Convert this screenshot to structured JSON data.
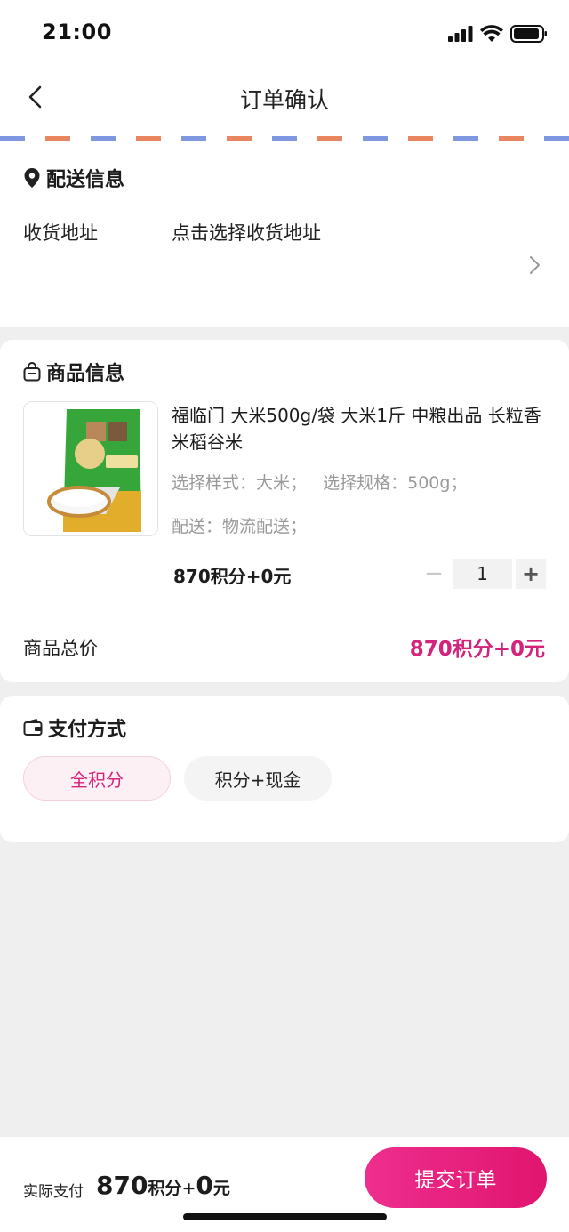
{
  "status_bar": {
    "time": "21:00"
  },
  "nav": {
    "title": "订单确认"
  },
  "stripe_colors": {
    "blue": "#7f97e0",
    "orange": "#e98660"
  },
  "delivery": {
    "title": "配送信息",
    "address_label": "收货地址",
    "address_placeholder": "点击选择收货地址"
  },
  "goods": {
    "title": "商品信息",
    "product": {
      "name": "福临门 大米500g/袋 大米1斤 中粮出品 长粒香米稻谷米",
      "spec": "选择样式：大米；   选择规格：500g；",
      "delivery": "配送：物流配送；",
      "price": "870积分+0元",
      "quantity": "1",
      "minus_symbol": "−",
      "plus_symbol": "+"
    },
    "total_label": "商品总价",
    "total_value": "870积分+0元"
  },
  "payment": {
    "title": "支付方式",
    "options": [
      {
        "label": "全积分",
        "selected": true
      },
      {
        "label": "积分+现金",
        "selected": false
      }
    ]
  },
  "footer": {
    "pay_label": "实际支付",
    "amount_points": "870",
    "amount_points_unit": "积分",
    "amount_plus": "+",
    "amount_cash": "0",
    "amount_cash_unit": "元",
    "submit_label": "提交订单"
  },
  "colors": {
    "accent": "#d4237a",
    "button_start": "#ee2e8e",
    "button_end": "#e0156f"
  },
  "icons": {
    "back": "chevron-left-icon",
    "location": "location-pin-icon",
    "goods": "shopping-bag-icon",
    "wallet": "wallet-icon",
    "chevron": "chevron-right-icon"
  }
}
